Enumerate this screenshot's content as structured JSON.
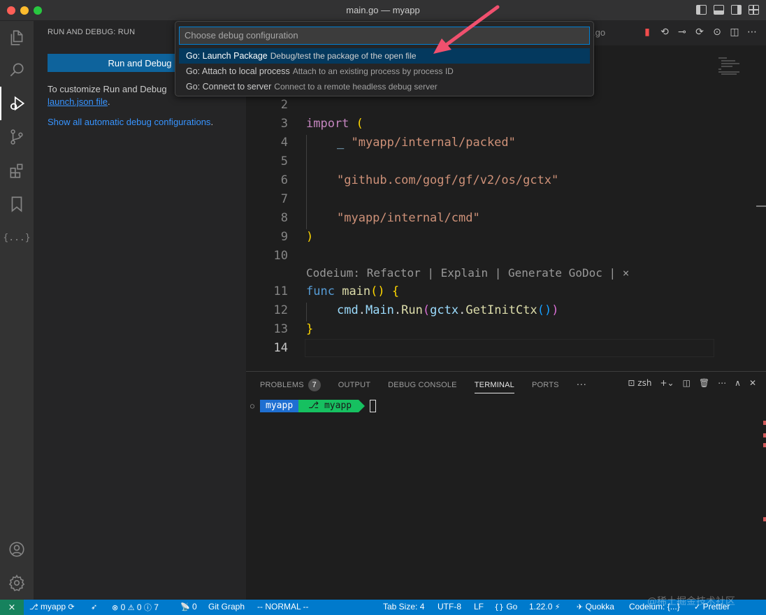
{
  "window": {
    "title": "main.go — myapp"
  },
  "activity_bar": [
    "explorer-icon",
    "search-icon",
    "run-debug-icon",
    "source-control-icon",
    "extensions-icon",
    "bookmarks-icon",
    "json-icon",
    "account-icon",
    "settings-icon"
  ],
  "sidebar": {
    "title": "RUN AND DEBUG: RUN",
    "run_button": "Run and Debug",
    "text_prefix": "To customize Run and Debug",
    "launch_link": "launch.json file",
    "text_period": ".",
    "show_all_link": "Show all automatic debug configurations",
    "show_all_period": "."
  },
  "quick_pick": {
    "placeholder": "Choose debug configuration",
    "items": [
      {
        "label": "Go: Launch Package",
        "description": "Debug/test the package of the open file",
        "selected": true
      },
      {
        "label": "Go: Attach to local process",
        "description": "Attach to an existing process by process ID",
        "selected": false
      },
      {
        "label": "Go: Connect to server",
        "description": "Connect to a remote headless debug server",
        "selected": false
      }
    ]
  },
  "editor": {
    "tab_fragment": ".go",
    "line_numbers": [
      "2",
      "3",
      "4",
      "5",
      "6",
      "7",
      "8",
      "9",
      "10",
      "11",
      "12",
      "13",
      "14"
    ],
    "code": {
      "import_kw": "import",
      "open_paren": " (",
      "blank_import": "_ ",
      "pkg_packed": "\"myapp/internal/packed\"",
      "pkg_gctx": "\"github.com/gogf/gf/v2/os/gctx\"",
      "pkg_cmd": "\"myapp/internal/cmd\"",
      "close_paren": ")",
      "func_kw": "func",
      "main_fn": "main",
      "main_parens": "()",
      "open_brace": "{",
      "cmd_var": "cmd",
      "main_field": "Main",
      "run_fn": "Run",
      "gctx_var": "gctx",
      "getinit_fn": "GetInitCtx",
      "close_brace": "}"
    },
    "codelens": "Codeium: Refactor | Explain | Generate GoDoc | ×"
  },
  "panel": {
    "tabs": [
      "PROBLEMS",
      "OUTPUT",
      "DEBUG CONSOLE",
      "TERMINAL",
      "PORTS"
    ],
    "active_tab": "TERMINAL",
    "problems_count": "7",
    "more": "···",
    "shell": "zsh",
    "prompt_seg1": "myapp",
    "prompt_seg2": "myapp"
  },
  "status_bar": {
    "branch": "myapp",
    "errors": "0",
    "warnings": "0",
    "infos": "7",
    "ports": "0",
    "git_graph": "Git Graph",
    "vim_mode": "-- NORMAL --",
    "tab_size": "Tab Size: 4",
    "encoding": "UTF-8",
    "eol": "LF",
    "language": "Go",
    "go_version": "1.22.0",
    "quokka": "Quokka",
    "codeium": "Codeium: {...}",
    "prettier": "Prettier",
    "watermark": "@稀土掘金技术社区"
  },
  "colors": {
    "accent": "#007acc",
    "selection": "#04395e",
    "arrow": "#f0506e"
  }
}
